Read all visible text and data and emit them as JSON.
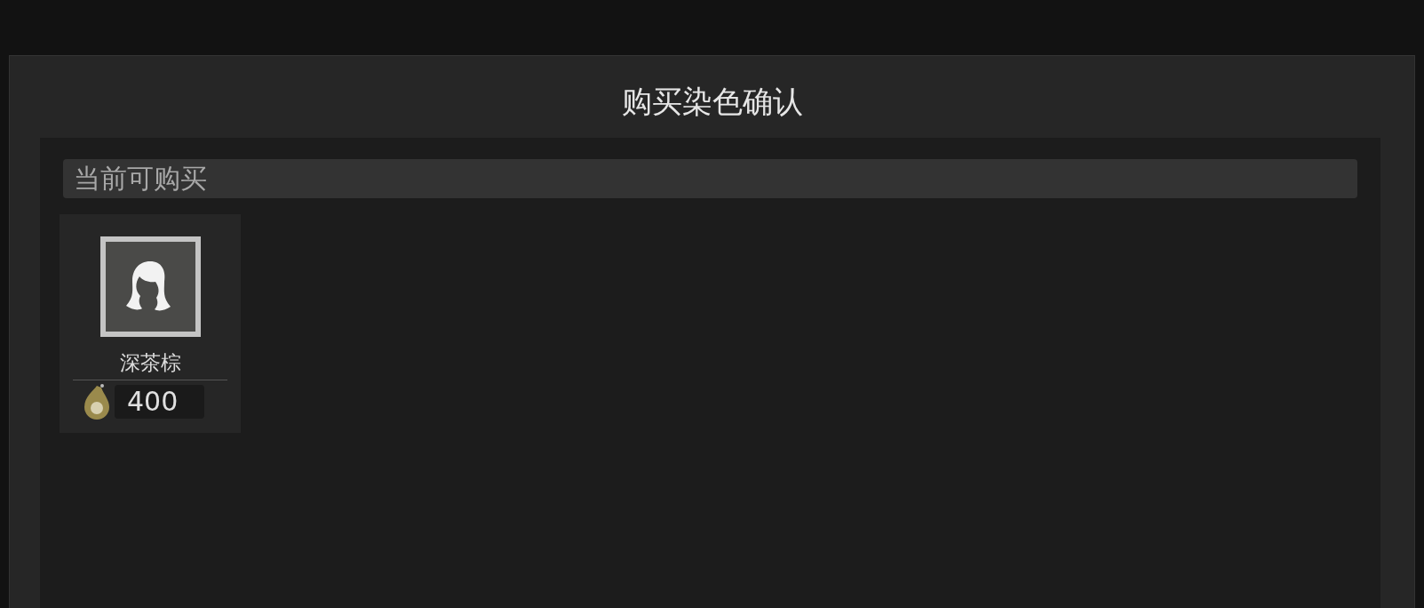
{
  "dialog": {
    "title": "购买染色确认"
  },
  "section": {
    "title": "当前可购买"
  },
  "items": [
    {
      "name": "深茶棕",
      "price": "400"
    }
  ]
}
